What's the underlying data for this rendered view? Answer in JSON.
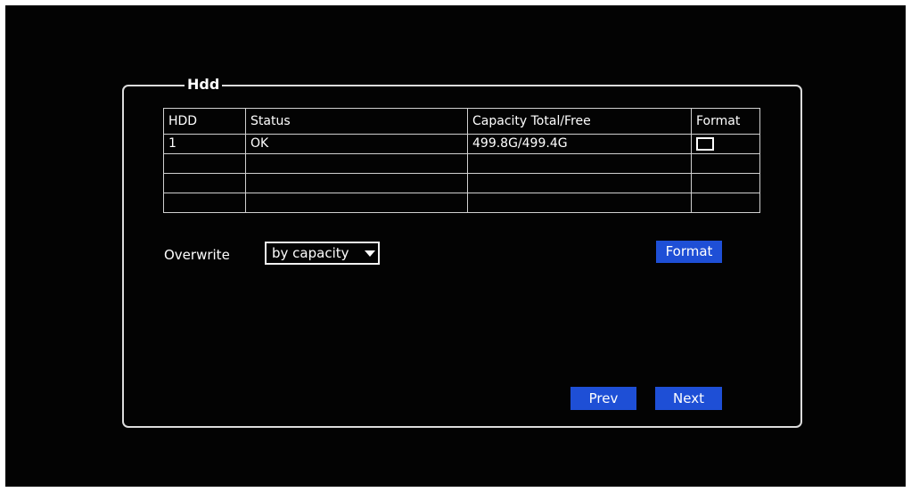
{
  "panel": {
    "title": "Hdd"
  },
  "table": {
    "headers": [
      "HDD",
      "Status",
      "Capacity Total/Free",
      "Format"
    ],
    "rows": [
      {
        "hdd": "1",
        "status": "OK",
        "capacity": "499.8G/499.4G",
        "format_checked": false
      }
    ]
  },
  "overwrite": {
    "label": "Overwrite",
    "value": "by capacity"
  },
  "buttons": {
    "format": "Format",
    "prev": "Prev",
    "next": "Next"
  },
  "colors": {
    "background": "#030303",
    "button": "#1e4fd6",
    "border": "#dcdcdc",
    "text": "#ffffff"
  }
}
